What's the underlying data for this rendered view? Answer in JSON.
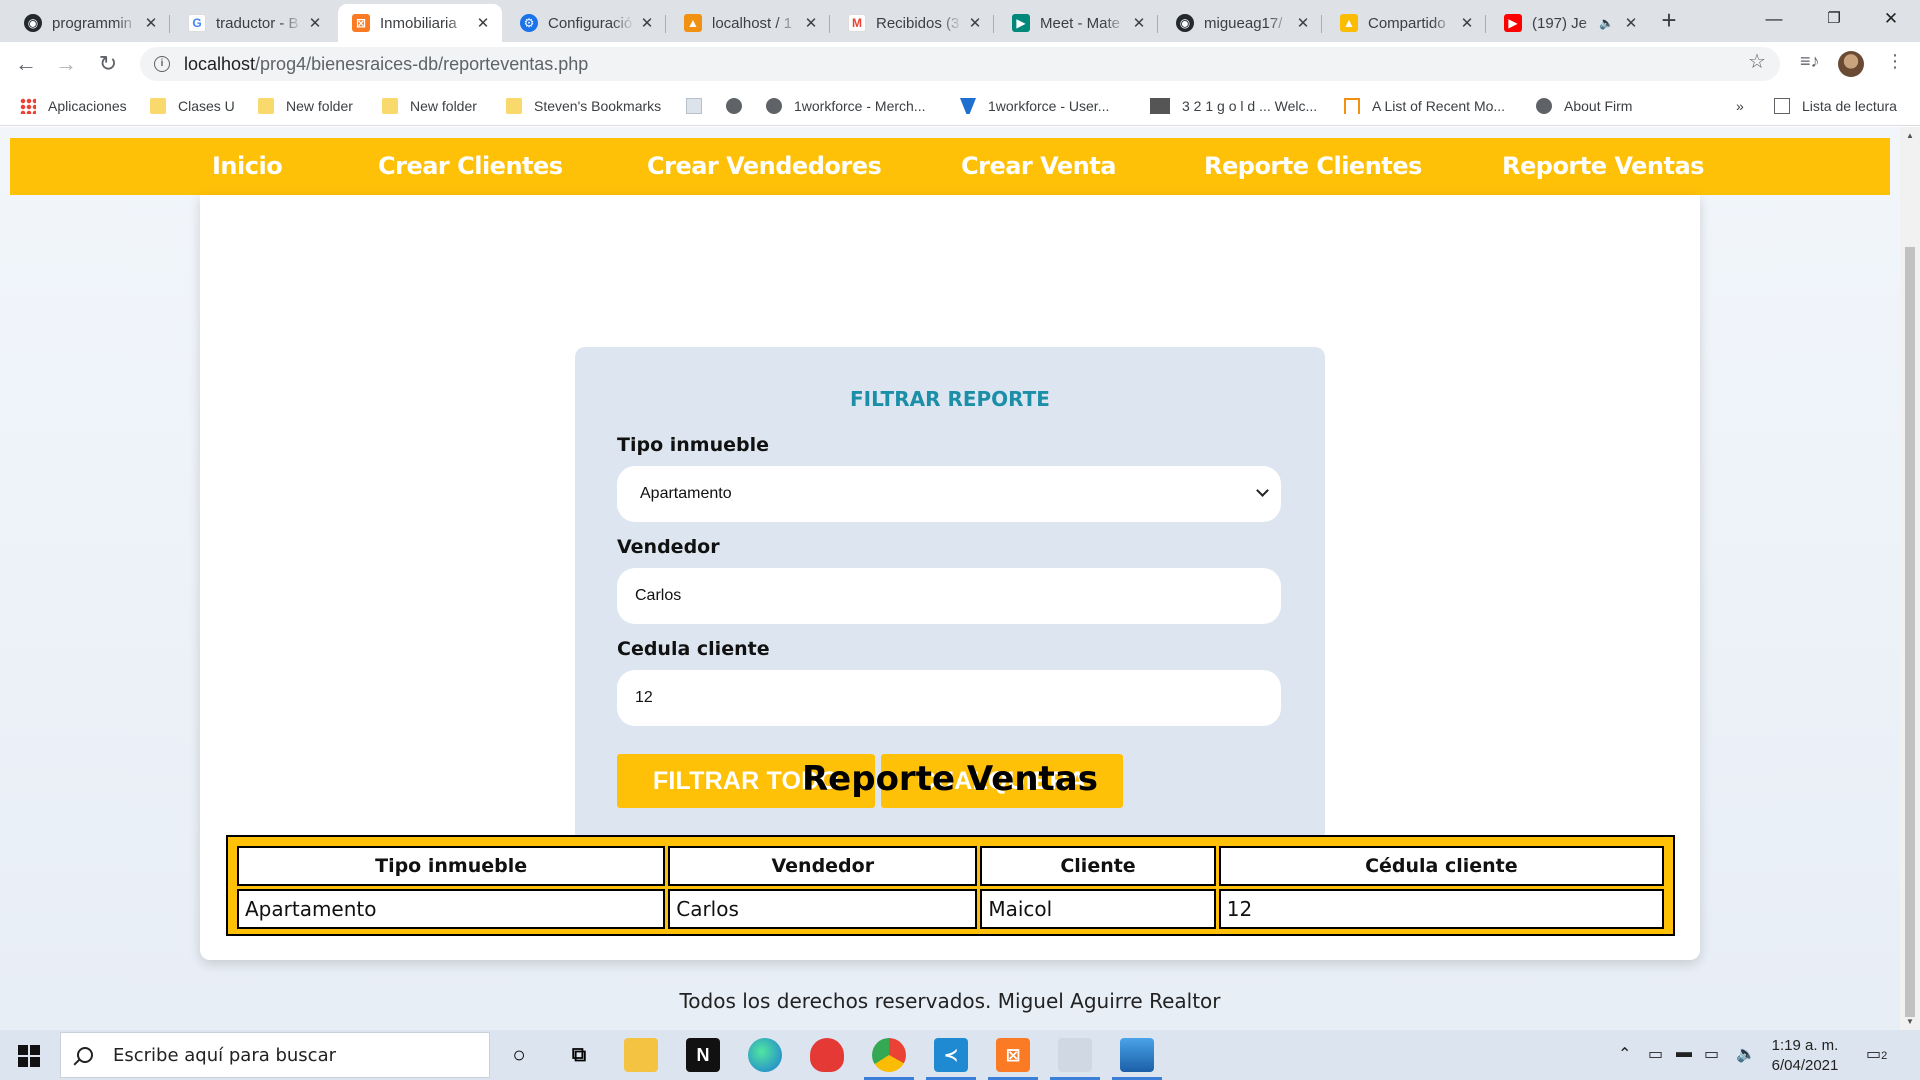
{
  "browser": {
    "tabs": [
      {
        "title": "programmin",
        "icon": "github-icon",
        "color": "#24292e"
      },
      {
        "title": "traductor - B",
        "icon": "google-icon",
        "color": "#4285f4"
      },
      {
        "title": "Inmobiliaria",
        "icon": "xampp-icon",
        "color": "#fb7a24",
        "active": true
      },
      {
        "title": "Configuració",
        "icon": "gear-icon",
        "color": "#1a73e8"
      },
      {
        "title": "localhost / 1",
        "icon": "phpmyadmin-icon",
        "color": "#f29111"
      },
      {
        "title": "Recibidos (3",
        "icon": "gmail-icon",
        "color": "#ea4335"
      },
      {
        "title": "Meet - Mate",
        "icon": "meet-icon",
        "color": "#00897b"
      },
      {
        "title": "migueag17/",
        "icon": "github-icon",
        "color": "#24292e"
      },
      {
        "title": "Compartido",
        "icon": "drive-icon",
        "color": "#fbbc04"
      },
      {
        "title": "(197) Je",
        "icon": "youtube-icon",
        "color": "#ff0000"
      }
    ],
    "new_tab_label": "+",
    "url_host": "localhost",
    "url_path": "/prog4/bienesraices-db/reporteventas.php",
    "bookmarks": [
      {
        "label": "Aplicaciones",
        "icon": "apps-grid-icon"
      },
      {
        "label": "Clases U",
        "icon": "folder-icon"
      },
      {
        "label": "New folder",
        "icon": "folder-icon"
      },
      {
        "label": "New folder",
        "icon": "folder-icon"
      },
      {
        "label": "Steven's Bookmarks",
        "icon": "folder-icon"
      },
      {
        "label": "",
        "icon": "doc-icon"
      },
      {
        "label": "",
        "icon": "globe-icon"
      },
      {
        "label": "1workforce - Merch...",
        "icon": "globe-icon"
      },
      {
        "label": "1workforce - User...",
        "icon": "workforce-icon"
      },
      {
        "label": "3 2 1 g o l d ... Welc...",
        "icon": "321-icon"
      },
      {
        "label": "A List of Recent Mo...",
        "icon": "house-icon"
      },
      {
        "label": "About Firm",
        "icon": "globe-icon"
      }
    ],
    "bookmarks_more": "»",
    "reading_list": "Lista de lectura"
  },
  "nav": {
    "items": [
      "Inicio",
      "Crear Clientes",
      "Crear Vendedores",
      "Crear Venta",
      "Reporte Clientes",
      "Reporte Ventas"
    ]
  },
  "filter": {
    "title": "FILTRAR REPORTE",
    "tipo_label": "Tipo inmueble",
    "tipo_value": "Apartamento",
    "vendedor_label": "Vendedor",
    "vendedor_value": "Carlos",
    "cedula_label": "Cedula cliente",
    "cedula_value": "12",
    "btn_all": "FILTRAR TODO",
    "btn_any": "CUALQUIERA"
  },
  "report": {
    "title": "Reporte Ventas",
    "columns": [
      "Tipo inmueble",
      "Vendedor",
      "Cliente",
      "Cédula cliente"
    ],
    "rows": [
      [
        "Apartamento",
        "Carlos",
        "Maicol",
        "12"
      ]
    ]
  },
  "footer": "Todos los derechos reservados. Miguel Aguirre Realtor",
  "taskbar": {
    "search_placeholder": "Escribe aquí para buscar",
    "time": "1:19 a. m.",
    "date": "6/04/2021",
    "notifications": "2"
  },
  "colors": {
    "accent": "#ffc107",
    "filter_title": "#1b8fa8",
    "filter_bg": "#dde6f0"
  }
}
